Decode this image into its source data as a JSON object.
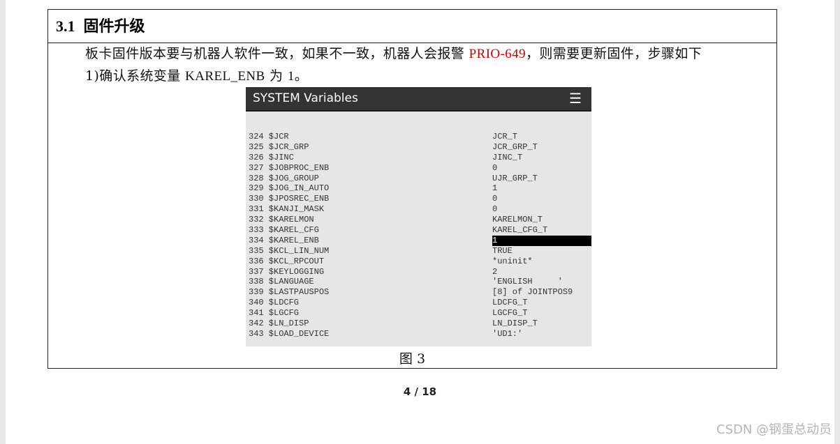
{
  "section": {
    "number": "3.1",
    "title": "固件升级"
  },
  "paragraph1": {
    "before": "板卡固件版本要与机器人软件一致，如果不一致，机器人会报警 ",
    "alarm": "PRIO-649",
    "after": "，则需要更新固件，步骤如下"
  },
  "paragraph2": {
    "prefix": "1)确认系统变量 ",
    "var": "KAREL_ENB",
    "mid": " 为 ",
    "value": "1",
    "suffix": "。"
  },
  "screen": {
    "title": "SYSTEM Variables",
    "menu_icon": "☰",
    "rows": [
      {
        "index": "324",
        "name": "$JCR",
        "value": "JCR_T"
      },
      {
        "index": "325",
        "name": "$JCR_GRP",
        "value": "JCR_GRP_T"
      },
      {
        "index": "326",
        "name": "$JINC",
        "value": "JINC_T"
      },
      {
        "index": "327",
        "name": "$JOBPROC_ENB",
        "value": "0"
      },
      {
        "index": "328",
        "name": "$JOG_GROUP",
        "value": "UJR_GRP_T"
      },
      {
        "index": "329",
        "name": "$JOG_IN_AUTO",
        "value": "1"
      },
      {
        "index": "330",
        "name": "$JPOSREC_ENB",
        "value": "0"
      },
      {
        "index": "331",
        "name": "$KANJI_MASK",
        "value": "0"
      },
      {
        "index": "332",
        "name": "$KARELMON",
        "value": "KARELMON_T"
      },
      {
        "index": "333",
        "name": "$KAREL_CFG",
        "value": "KAREL_CFG_T"
      },
      {
        "index": "334",
        "name": "$KAREL_ENB",
        "value": "1",
        "selected": true
      },
      {
        "index": "335",
        "name": "$KCL_LIN_NUM",
        "value": "TRUE"
      },
      {
        "index": "336",
        "name": "$KCL_RPCOUT",
        "value": "*uninit*"
      },
      {
        "index": "337",
        "name": "$KEYLOGGING",
        "value": "2"
      },
      {
        "index": "338",
        "name": "$LANGUAGE",
        "value": "'ENGLISH     '"
      },
      {
        "index": "339",
        "name": "$LASTPAUSPOS",
        "value": "[8] of JOINTPOS9"
      },
      {
        "index": "340",
        "name": "$LDCFG",
        "value": "LDCFG_T"
      },
      {
        "index": "341",
        "name": "$LGCFG",
        "value": "LGCFG_T"
      },
      {
        "index": "342",
        "name": "$LN_DISP",
        "value": "LN_DISP_T"
      },
      {
        "index": "343",
        "name": "$LOAD_DEVICE",
        "value": "'UD1:'"
      }
    ]
  },
  "caption": "图 3",
  "page_number": "4 / 18",
  "watermark": "CSDN @钢蛋总动员"
}
